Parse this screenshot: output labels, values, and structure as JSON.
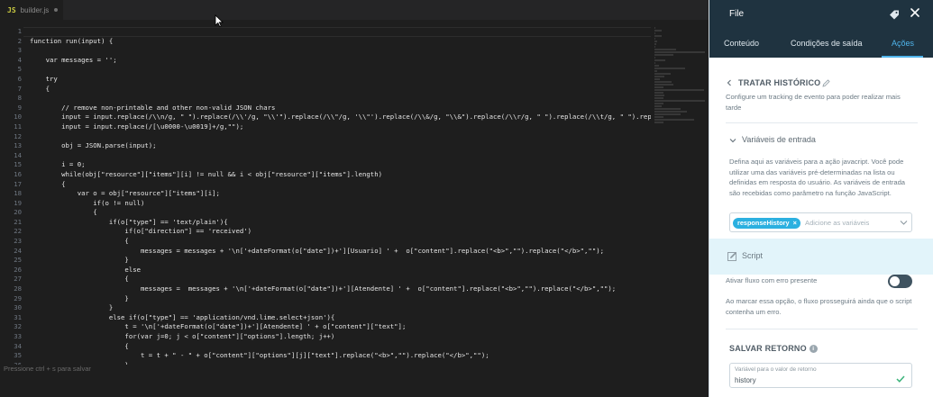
{
  "editor": {
    "tab": {
      "icon": "JS",
      "filename": "builder.js"
    },
    "status_hint": "Pressione ctrl + s para salvar",
    "code_lines": [
      {
        "n": "1",
        "text": ""
      },
      {
        "n": "2",
        "text": "function run(input) {"
      },
      {
        "n": "3",
        "text": ""
      },
      {
        "n": "4",
        "text": "    var messages = '';"
      },
      {
        "n": "5",
        "text": ""
      },
      {
        "n": "6",
        "text": "    try"
      },
      {
        "n": "7",
        "text": "    {"
      },
      {
        "n": "8",
        "text": ""
      },
      {
        "n": "9",
        "text": "        // remove non-printable and other non-valid JSON chars"
      },
      {
        "n": "10",
        "text": "        input = input.replace(/\\\\n/g, \" \").replace(/\\\\'/g, \"\\\\'\").replace(/\\\\\"/g, '\\\\\"').replace(/\\\\&/g, \"\\\\&\").replace(/\\\\r/g, \" \").replace(/\\\\t/g, \" \").replace(/\\"
      },
      {
        "n": "11",
        "text": "        input = input.replace(/[\\u0000-\\u0019]+/g,\"\");"
      },
      {
        "n": "12",
        "text": ""
      },
      {
        "n": "13",
        "text": "        obj = JSON.parse(input);"
      },
      {
        "n": "14",
        "text": ""
      },
      {
        "n": "15",
        "text": "        i = 0;"
      },
      {
        "n": "16",
        "text": "        while(obj[\"resource\"][\"items\"][i] != null && i < obj[\"resource\"][\"items\"].length)"
      },
      {
        "n": "17",
        "text": "        {"
      },
      {
        "n": "18",
        "text": "            var o = obj[\"resource\"][\"items\"][i];"
      },
      {
        "n": "19",
        "text": "                if(o != null)"
      },
      {
        "n": "20",
        "text": "                {"
      },
      {
        "n": "21",
        "text": "                    if(o[\"type\"] == 'text/plain'){"
      },
      {
        "n": "22",
        "text": "                        if(o[\"direction\"] == 'received')"
      },
      {
        "n": "23",
        "text": "                        {"
      },
      {
        "n": "24",
        "text": "                            messages = messages + '\\n['+dateFormat(o[\"date\"])+'][Usuario] ' +  o[\"content\"].replace(\"<b>\",\"\").replace(\"</b>\",\"\");"
      },
      {
        "n": "25",
        "text": "                        }"
      },
      {
        "n": "26",
        "text": "                        else"
      },
      {
        "n": "27",
        "text": "                        {"
      },
      {
        "n": "28",
        "text": "                            messages =  messages + '\\n['+dateFormat(o[\"date\"])+'][Atendente] ' +  o[\"content\"].replace(\"<b>\",\"\").replace(\"</b>\",\"\");"
      },
      {
        "n": "29",
        "text": "                        }"
      },
      {
        "n": "30",
        "text": "                    }"
      },
      {
        "n": "31",
        "text": "                    else if(o[\"type\"] == 'application/vnd.lime.select+json'){"
      },
      {
        "n": "32",
        "text": "                        t = '\\n['+dateFormat(o[\"date\"])+'][Atendente] ' + o[\"content\"][\"text\"];"
      },
      {
        "n": "33",
        "text": "                        for(var j=0; j < o[\"content\"][\"options\"].length; j++)"
      },
      {
        "n": "34",
        "text": "                        {"
      },
      {
        "n": "35",
        "text": "                            t = t + \" - \" + o[\"content\"][\"options\"][j][\"text\"].replace(\"<b>\",\"\").replace(\"</b>\",\"\");"
      },
      {
        "n": "36",
        "text": "                        }"
      }
    ]
  },
  "panel": {
    "title": "File",
    "tabs": [
      "Conteúdo",
      "Condições de saída",
      "Ações"
    ],
    "active_tab": "Ações",
    "action_title": "TRATAR HISTÓRICO",
    "action_desc": "Configure um tracking de evento para poder realizar mais tarde",
    "input_vars_title": "Variáveis de entrada",
    "input_vars_desc": "Defina aqui as variáveis para a ação javacript. Você pode utilizar uma das variáveis pré-determinadas na lista ou definidas em resposta do usuário. As variáveis de entrada são recebidas como parâmetro na função JavaScript.",
    "input_vars_chip": "responseHistory",
    "input_vars_placeholder": "Adicione as variáveis",
    "script_label": "Script",
    "error_flow_label": "Ativar fluxo com erro presente",
    "error_flow_enabled": false,
    "error_flow_desc": "Ao marcar essa opção, o fluxo prosseguirá ainda que o script contenha um erro.",
    "return_title": "SALVAR RETORNO",
    "return_field_label": "Variável para o valor de retorno",
    "return_field_value": "history"
  },
  "colors": {
    "editor_bg": "#1e1e1e",
    "panel_header": "#1f3340",
    "accent": "#4fb4ea",
    "chip": "#2bb0e0",
    "script_highlight": "#e2f4fa"
  }
}
